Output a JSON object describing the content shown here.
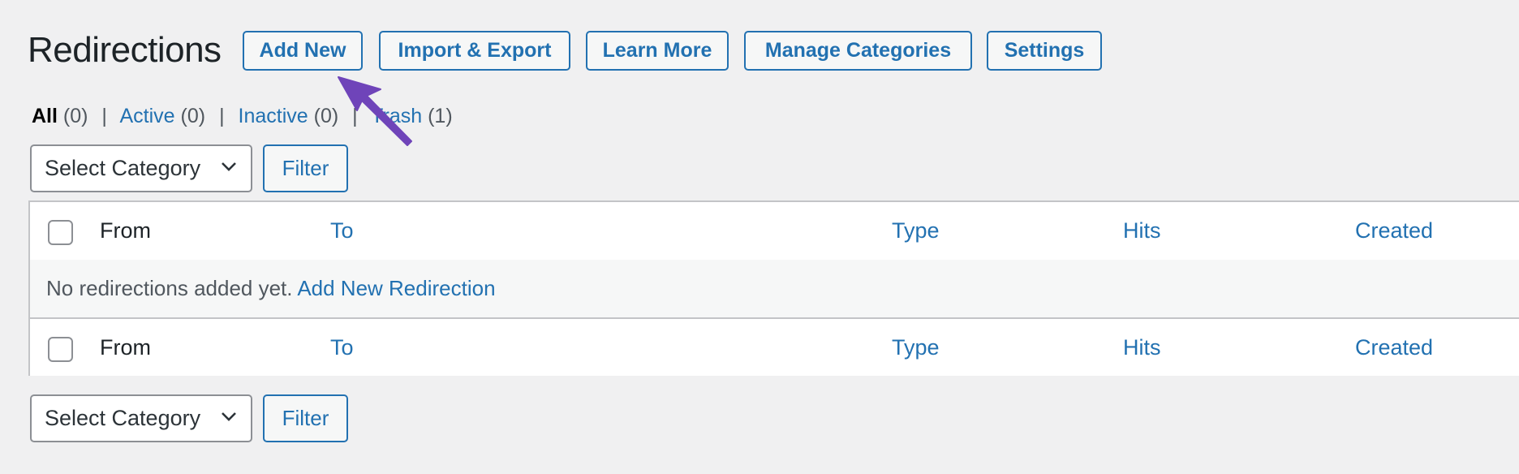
{
  "page": {
    "title": "Redirections",
    "actions": [
      {
        "id": "add-new",
        "label": "Add New"
      },
      {
        "id": "import-export",
        "label": "Import & Export"
      },
      {
        "id": "learn-more",
        "label": "Learn More"
      },
      {
        "id": "manage-categories",
        "label": "Manage Categories"
      },
      {
        "id": "settings",
        "label": "Settings"
      }
    ]
  },
  "views": {
    "all": {
      "label": "All",
      "count": "(0)"
    },
    "active": {
      "label": "Active",
      "count": "(0)"
    },
    "inactive": {
      "label": "Inactive",
      "count": "(0)"
    },
    "trash": {
      "label": "Trash",
      "count": "(1)"
    },
    "separator": "|"
  },
  "filters": {
    "top": {
      "category_select": "Select Category",
      "filter_button": "Filter"
    },
    "bottom": {
      "category_select": "Select Category",
      "filter_button": "Filter"
    }
  },
  "table": {
    "columns": [
      "From",
      "To",
      "Type",
      "Hits",
      "Created"
    ],
    "empty_message": "No redirections added yet.",
    "empty_link": "Add New Redirection"
  },
  "annotation": {
    "type": "arrow",
    "color": "#6f44b9",
    "points_to": "Add New"
  },
  "colors": {
    "accent": "#2271b1",
    "background": "#f0f0f1",
    "border": "#c3c4c7"
  }
}
